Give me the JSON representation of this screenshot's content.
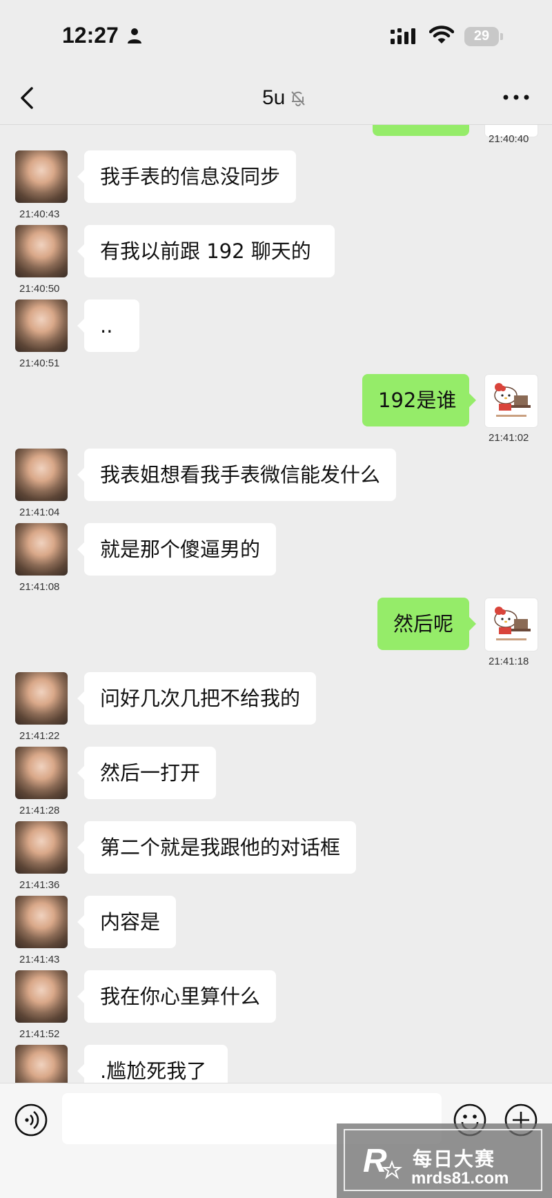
{
  "status_bar": {
    "time": "12:27",
    "battery": "29"
  },
  "header": {
    "title": "5u"
  },
  "top_partial": {
    "timestamp": "21:40:40"
  },
  "messages": [
    {
      "side": "in",
      "text": "我手表的信息没同步",
      "time": "21:40:43"
    },
    {
      "side": "in",
      "text": "有我以前跟 192 聊天的",
      "time": "21:40:50"
    },
    {
      "side": "in",
      "text": "..",
      "time": "21:40:51"
    },
    {
      "side": "out",
      "text": "192是谁",
      "time": "21:41:02"
    },
    {
      "side": "in",
      "text": "我表姐想看我手表微信能发什么",
      "time": "21:41:04"
    },
    {
      "side": "in",
      "text": "就是那个傻逼男的",
      "time": "21:41:08"
    },
    {
      "side": "out",
      "text": "然后呢",
      "time": "21:41:18"
    },
    {
      "side": "in",
      "text": "问好几次几把不给我的",
      "time": "21:41:22"
    },
    {
      "side": "in",
      "text": "然后一打开",
      "time": "21:41:28"
    },
    {
      "side": "in",
      "text": "第二个就是我跟他的对话框",
      "time": "21:41:36"
    },
    {
      "side": "in",
      "text": "内容是",
      "time": "21:41:43"
    },
    {
      "side": "in",
      "text": "我在你心里算什么",
      "time": "21:41:52"
    },
    {
      "side": "in",
      "text": ".尴尬死我了",
      "time": ""
    }
  ],
  "input": {
    "value": ""
  },
  "watermark": {
    "name": "每日大赛",
    "url": "mrds81.com",
    "logo_letter": "R"
  },
  "colors": {
    "background": "#ededed",
    "incoming_bubble": "#ffffff",
    "outgoing_bubble": "#95ec69"
  }
}
